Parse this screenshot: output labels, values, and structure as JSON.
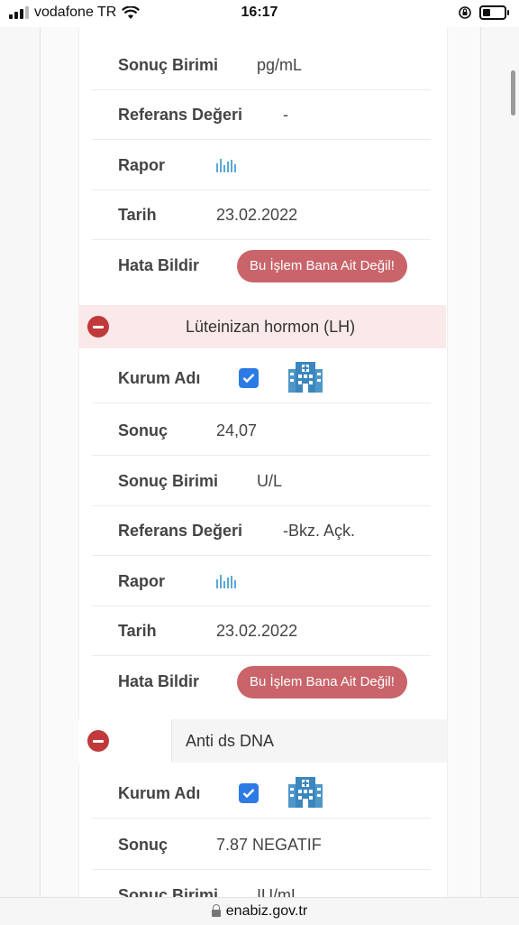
{
  "status_bar": {
    "carrier": "vodafone TR",
    "time": "16:17",
    "battery_icon": "battery-low-icon",
    "wifi_icon": "wifi-icon",
    "orientation_icon": "orientation-lock-icon"
  },
  "sections": [
    {
      "rows": [
        {
          "label": "Sonuç Birimi",
          "value": "pg/mL"
        },
        {
          "label": "Referans Değeri",
          "value": "-"
        },
        {
          "label": "Rapor",
          "icon": "bar-chart-icon"
        },
        {
          "label": "Tarih",
          "value": "23.02.2022"
        },
        {
          "label": "Hata Bildir",
          "button": "Bu İşlem Bana Ait Değil!"
        }
      ]
    },
    {
      "title": "Lüteinizan hormon (LH)",
      "rows": [
        {
          "label": "Kurum Adı",
          "checked": true,
          "icon": "hospital-icon"
        },
        {
          "label": "Sonuç",
          "value": "24,07"
        },
        {
          "label": "Sonuç Birimi",
          "value": "U/L"
        },
        {
          "label": "Referans Değeri",
          "value": "-Bkz. Açk."
        },
        {
          "label": "Rapor",
          "icon": "bar-chart-icon"
        },
        {
          "label": "Tarih",
          "value": "23.02.2022"
        },
        {
          "label": "Hata Bildir",
          "button": "Bu İşlem Bana Ait Değil!"
        }
      ]
    },
    {
      "title": "Anti ds DNA",
      "rows": [
        {
          "label": "Kurum Adı",
          "checked": true,
          "icon": "hospital-icon"
        },
        {
          "label": "Sonuç",
          "value": "7.87 NEGATIF"
        },
        {
          "label": "Sonuç Birimi",
          "value": "IU/mL"
        }
      ]
    }
  ],
  "browser": {
    "url": "enabiz.gov.tr"
  },
  "colors": {
    "report_button": "#c9646a",
    "collapse_button": "#c0393b",
    "checkbox": "#2c7be5",
    "section_highlight": "#fbe9e9",
    "chart_icon": "#5aa9d6"
  }
}
